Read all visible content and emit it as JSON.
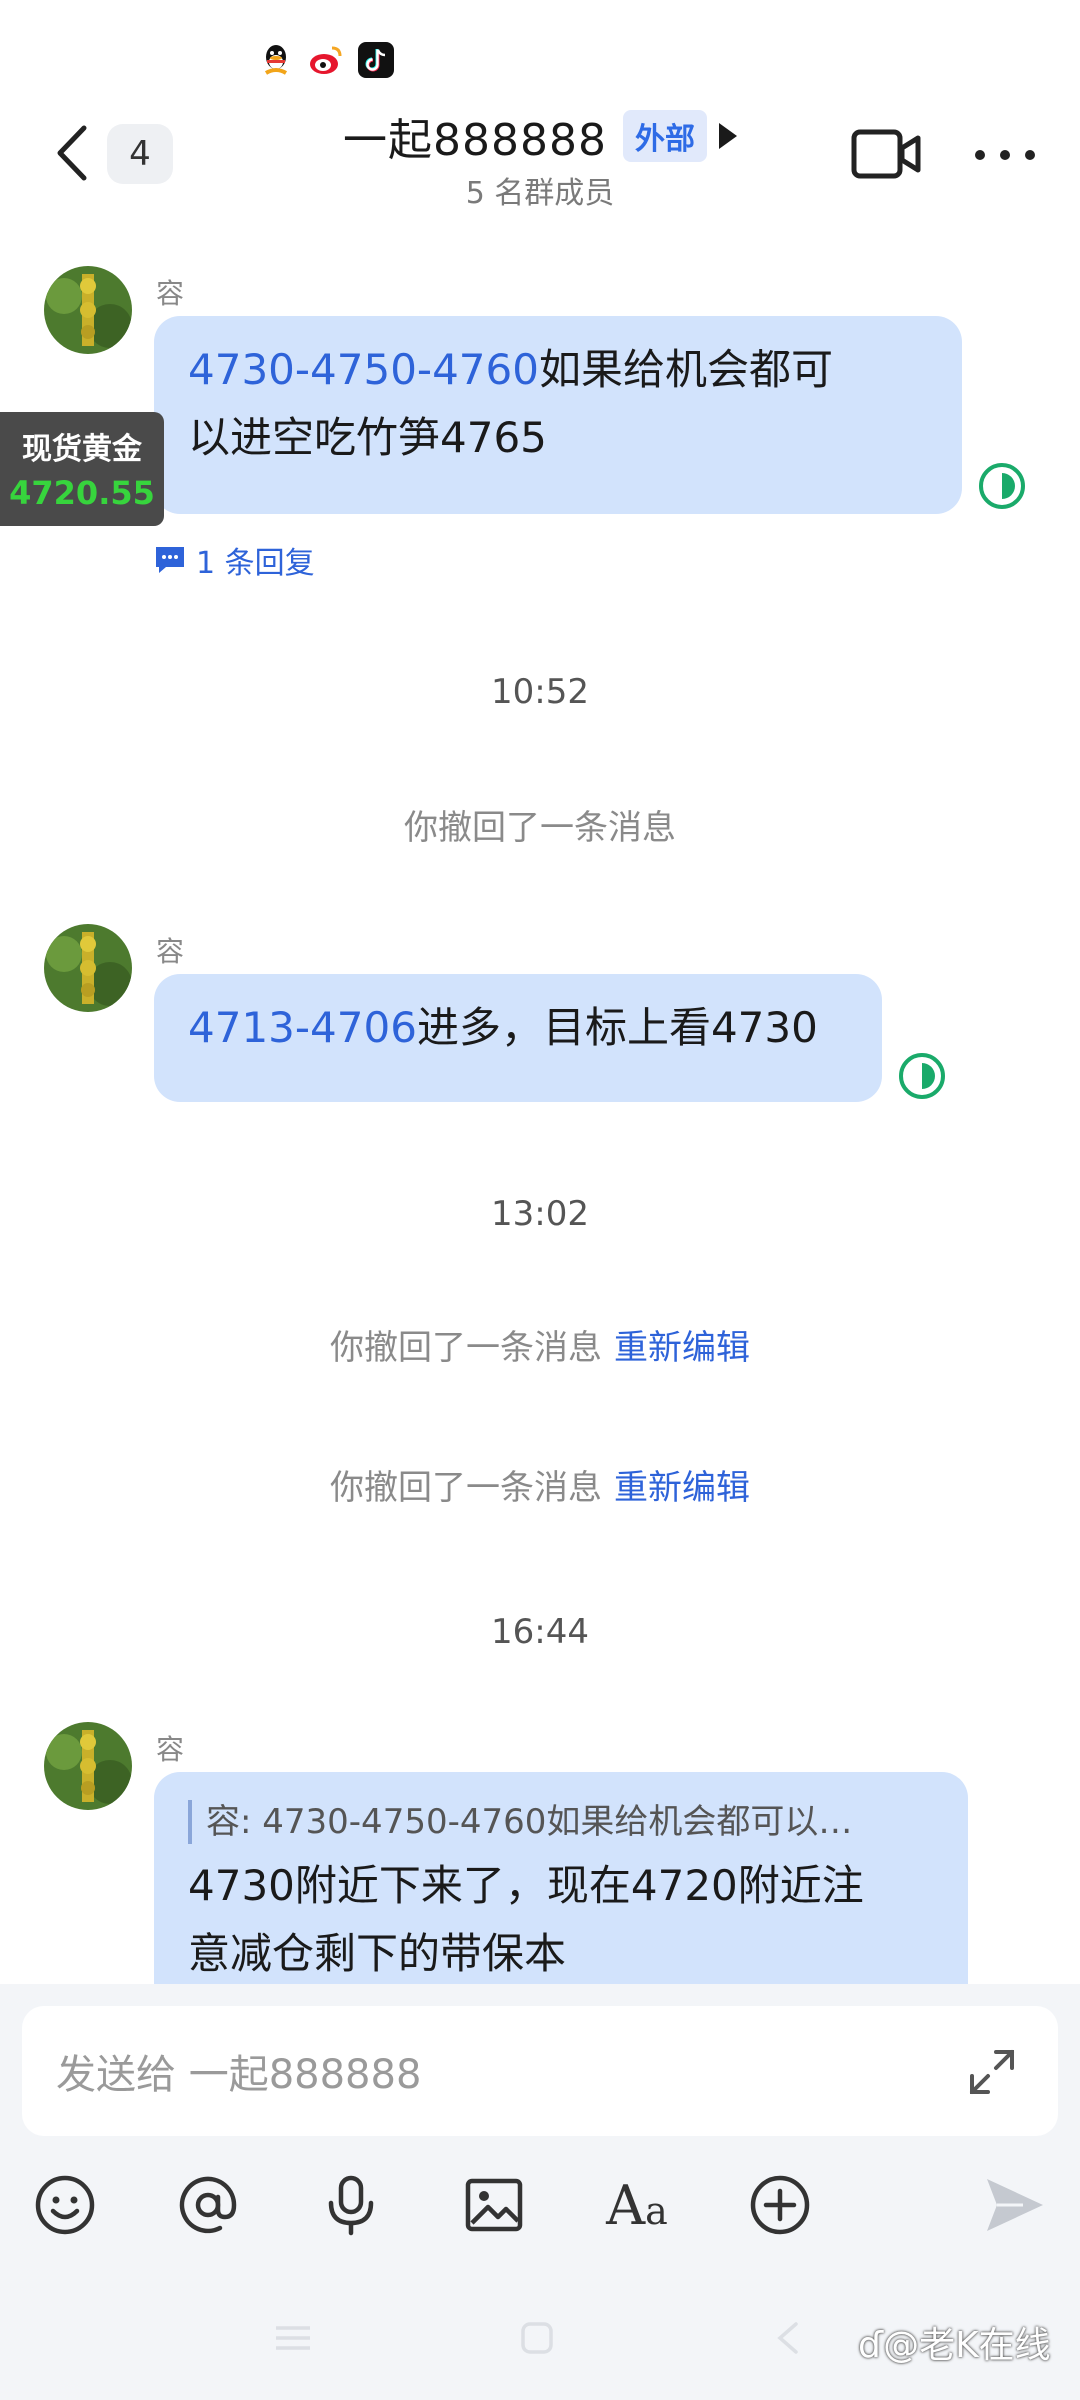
{
  "header": {
    "unread_count": "4",
    "title": "一起888888",
    "tag": "外部",
    "subtitle": "5 名群成员"
  },
  "gold_widget": {
    "label": "现货黄金",
    "value": "4720.55"
  },
  "messages": [
    {
      "sender": "容",
      "link_text": "4730-4750-4760",
      "line1_rest": "如果给机会都可",
      "line2": "以进空吃竹笋4765",
      "reply_label": "1 条回复"
    },
    {
      "sender": "容",
      "link_text": "4713-4706",
      "rest": "进多，目标上看4730"
    },
    {
      "sender": "容",
      "quote": "容: 4730-4750-4760如果给机会都可以…",
      "line1": "4730附近下来了，现在4720附近注",
      "line2": "意减仓剩下的带保本"
    }
  ],
  "timestamps": [
    "10:52",
    "13:02",
    "16:44"
  ],
  "system": {
    "recalled": "你撤回了一条消息",
    "reedit": "重新编辑"
  },
  "composer": {
    "placeholder": "发送给 一起888888"
  },
  "watermark": "@老K在线",
  "colors": {
    "bubble": "#d2e3fc",
    "link": "#2e63d9",
    "read_ring": "#1aaa6a",
    "gold_value": "#37d43d"
  }
}
